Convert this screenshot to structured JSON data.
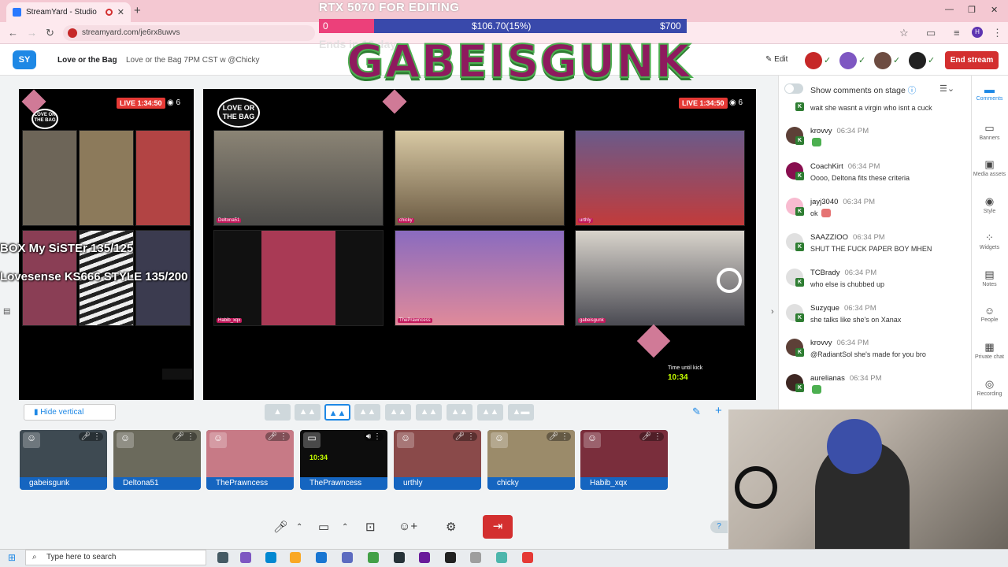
{
  "browser": {
    "tab_title": "StreamYard - Studio",
    "url": "streamyard.com/je6rx8uwvs"
  },
  "header": {
    "logo": "SY",
    "breadcrumb_broadcast": "Love or the Bag",
    "breadcrumb_title": "Love or the Bag 7PM CST w @Chicky",
    "edit_label": "Edit",
    "end_stream_label": "End stream"
  },
  "goal": {
    "title": "RTX 5070 FOR EDITING",
    "start": "0",
    "current": "$106.70(15%)",
    "target": "$700",
    "progress_fraction": 0.15,
    "ends": "Ends in 16 days"
  },
  "overlay": {
    "big_title": "GABEISGUNK",
    "left_text_1": "BOX My SiSTEr 135/125",
    "left_text_2": "Lovesense KS666 STYLE 135/200"
  },
  "stage": {
    "live_label": "LIVE 1:34:50",
    "viewers": "6",
    "logo_text": "LOVE OR THE BAG",
    "cams": [
      {
        "label": "Deltona51"
      },
      {
        "label": "chicky"
      },
      {
        "label": "urthly"
      },
      {
        "label": "Habib_xqx"
      },
      {
        "label": "ThePrawncess"
      },
      {
        "label": "gabeisgunk"
      }
    ],
    "timer_label": "Time until kick",
    "timer_value": "10:34"
  },
  "layout_bar": {
    "hide_vertical": "Hide vertical"
  },
  "participants": [
    {
      "name": "gabeisgunk",
      "color": "#3e4a52"
    },
    {
      "name": "Deltona51",
      "color": "#6b6a5c"
    },
    {
      "name": "ThePrawncess",
      "color": "#c77a86"
    },
    {
      "name": "ThePrawncess",
      "color": "#0d0d0d"
    },
    {
      "name": "urthly",
      "color": "#8a4a4a"
    },
    {
      "name": "chicky",
      "color": "#9b8b6a"
    },
    {
      "name": "Habib_xqx",
      "color": "#7a2e3c"
    }
  ],
  "comments": {
    "toggle_label": "Show comments on stage",
    "items": [
      {
        "user": "",
        "time": "",
        "text": "wait she wasnt a virgin who isnt a cuck",
        "avatar": "#4caf50",
        "emote": ""
      },
      {
        "user": "krovvy",
        "time": "06:34 PM",
        "text": "",
        "avatar": "#5d4037",
        "emote": "#4caf50"
      },
      {
        "user": "CoachKirt",
        "time": "06:34 PM",
        "text": "Oooo, Deltona fits these criteria",
        "avatar": "#880e4f",
        "emote": ""
      },
      {
        "user": "jayj3040",
        "time": "06:34 PM",
        "text": "ok",
        "avatar": "#f8bbd0",
        "emote": "#e57373"
      },
      {
        "user": "SAAZZIOO",
        "time": "06:34 PM",
        "text": "SHUT THE FUCK PAPER BOY MHEN",
        "avatar": "#e0e0e0",
        "emote": ""
      },
      {
        "user": "TCBrady",
        "time": "06:34 PM",
        "text": "who else is chubbed up",
        "avatar": "#e0e0e0",
        "emote": ""
      },
      {
        "user": "Suzyque",
        "time": "06:34 PM",
        "text": "she talks like she's on Xanax",
        "avatar": "#e0e0e0",
        "emote": ""
      },
      {
        "user": "krovvy",
        "time": "06:34 PM",
        "text": "@RadiantSol she's made for you bro",
        "avatar": "#5d4037",
        "emote": ""
      },
      {
        "user": "aurelianas",
        "time": "06:34 PM",
        "text": "",
        "avatar": "#3e2723",
        "emote": "#4caf50"
      }
    ]
  },
  "rail": [
    {
      "label": "Comments",
      "icon": "comment-icon",
      "glyph": "▬"
    },
    {
      "label": "Banners",
      "icon": "banner-icon",
      "glyph": "▭"
    },
    {
      "label": "Media assets",
      "icon": "image-icon",
      "glyph": "▣"
    },
    {
      "label": "Style",
      "icon": "palette-icon",
      "glyph": "◉"
    },
    {
      "label": "Widgets",
      "icon": "widgets-icon",
      "glyph": "⁘"
    },
    {
      "label": "Notes",
      "icon": "notes-icon",
      "glyph": "▤"
    },
    {
      "label": "People",
      "icon": "people-icon",
      "glyph": "☺"
    },
    {
      "label": "Private chat",
      "icon": "chat-icon",
      "glyph": "▦"
    },
    {
      "label": "Recording",
      "icon": "record-icon",
      "glyph": "◎"
    }
  ],
  "taskbar": {
    "search_placeholder": "Type here to search"
  },
  "colors": {
    "accent": "#1e88e5",
    "danger": "#d32f2f",
    "goal_bar": "#3949ab",
    "goal_fill": "#ec407a",
    "tab_strip": "#f4c8d2"
  }
}
